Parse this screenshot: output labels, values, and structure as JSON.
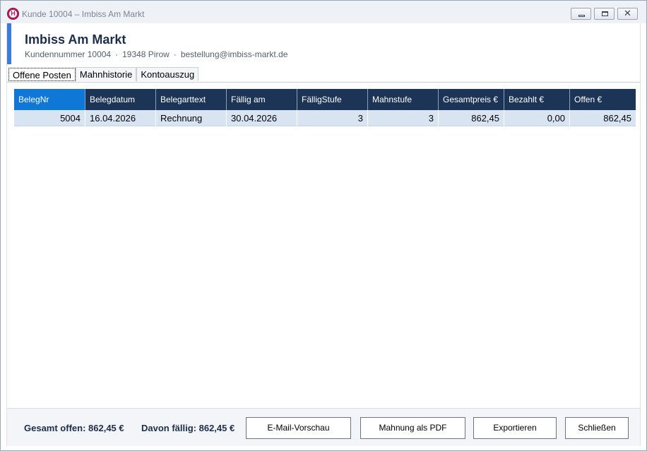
{
  "window": {
    "title": "Kunde 10004 – Imbiss Am Markt",
    "app_icon_letter": "H",
    "close_glyph": "✕"
  },
  "customer": {
    "name": "Imbiss Am Markt",
    "number_text": "Kundennummer 10004",
    "location": "19348 Pirow",
    "email": "bestellung@imbiss-markt.de",
    "separator": "·"
  },
  "tabs": [
    {
      "label": "Offene Posten",
      "active": true
    },
    {
      "label": "Mahnhistorie",
      "active": false
    },
    {
      "label": "Kontoauszug",
      "active": false
    }
  ],
  "grid": {
    "columns": [
      "BelegNr",
      "Belegdatum",
      "Belegarttext",
      "Fällig am",
      "FälligStufe",
      "Mahnstufe",
      "Gesamtpreis €",
      "Bezahlt €",
      "Offen €"
    ],
    "rows": [
      {
        "belegnr": "5004",
        "belegdatum": "16.04.2026",
        "belegarttext": "Rechnung",
        "faellig_am": "30.04.2026",
        "faellig_stufe": "3",
        "mahnstufe": "3",
        "gesamtpreis": "862,45",
        "bezahlt": "0,00",
        "offen": "862,45"
      }
    ]
  },
  "footer": {
    "total_open": "Gesamt offen: 862,45 €",
    "due": "Davon fällig: 862,45 €",
    "buttons": {
      "email_preview": "E-Mail-Vorschau",
      "dunning_pdf": "Mahnung als PDF",
      "export": "Exportieren",
      "close": "Schließen"
    }
  },
  "colors": {
    "header_bg": "#1c3557",
    "selected_header": "#0f78d7",
    "row_bg": "#d9e4f3",
    "accent": "#3d7bd9",
    "title_text": "#1c2e4a"
  },
  "icons": {
    "app": "app-logo-icon",
    "minimize": "minimize-icon",
    "maximize": "maximize-icon",
    "close": "close-icon"
  }
}
